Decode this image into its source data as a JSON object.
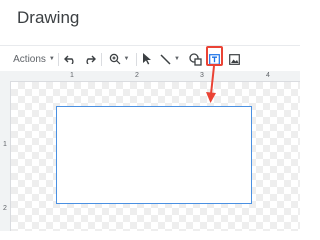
{
  "app": {
    "title": "Drawing"
  },
  "toolbar": {
    "actions_label": "Actions",
    "items": [
      "undo-icon",
      "redo-icon",
      "zoom-icon",
      "select-icon",
      "line-icon",
      "shape-icon",
      "text-box-icon",
      "image-icon"
    ]
  },
  "ruler": {
    "top_numbers": [
      "1",
      "2",
      "3",
      "4"
    ],
    "left_numbers": [
      "1",
      "2"
    ]
  },
  "colors": {
    "highlight": "#ea4335",
    "selection": "#4a90e2"
  }
}
